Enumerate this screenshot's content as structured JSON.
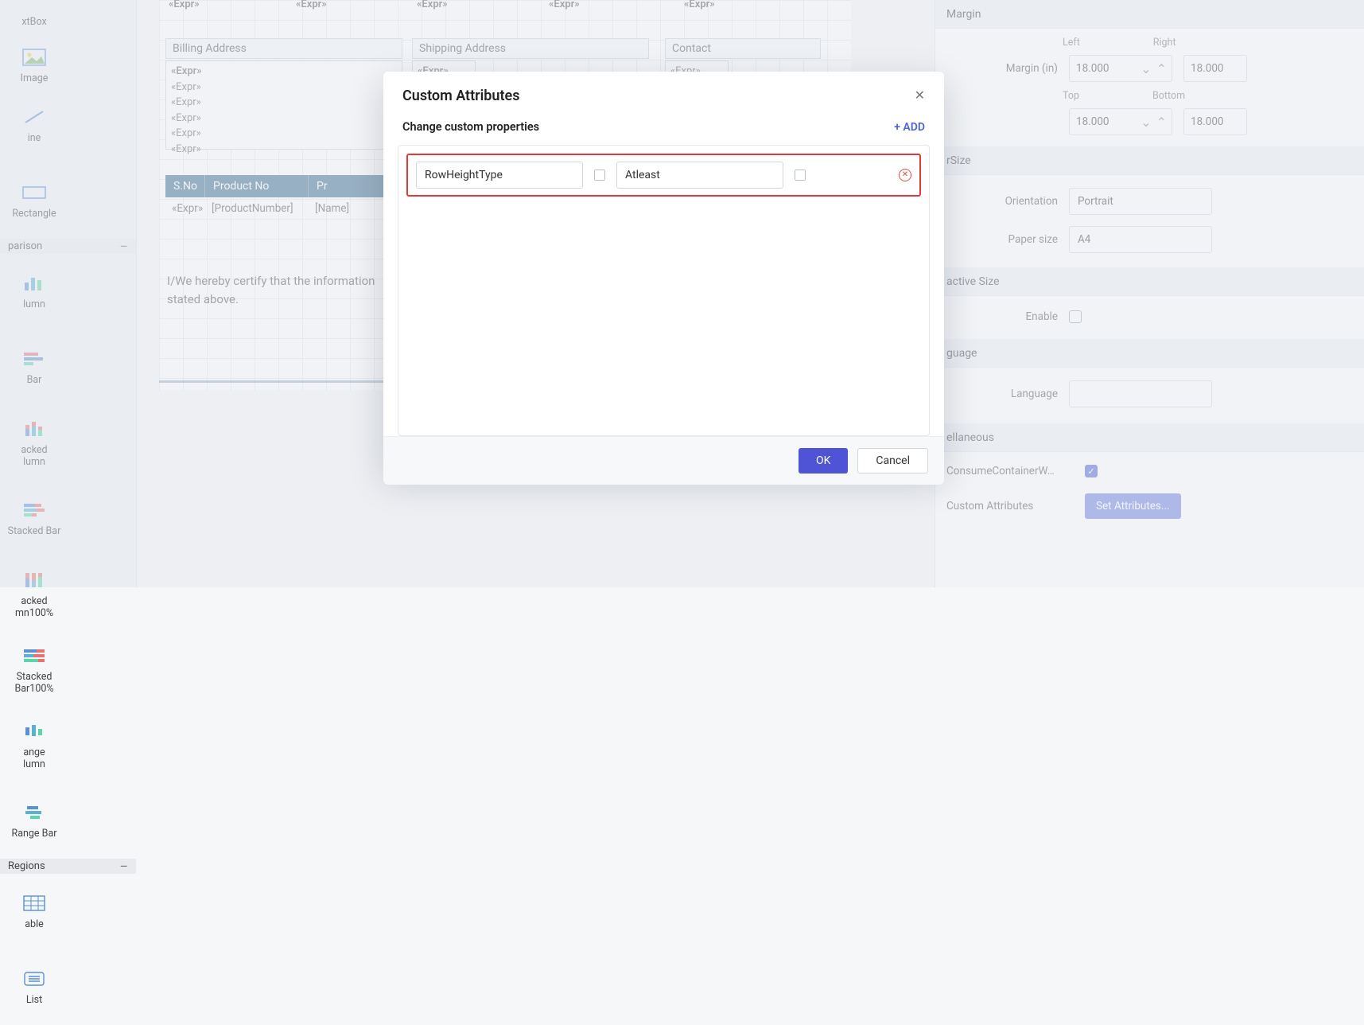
{
  "toolbox": {
    "row1": [
      {
        "label": "xtBox",
        "icon": "textbox"
      },
      {
        "label": "Image",
        "icon": "image"
      }
    ],
    "row2": [
      {
        "label": "ine",
        "icon": "line"
      },
      {
        "label": "Rectangle",
        "icon": "rect"
      }
    ],
    "comparison_head": "parison",
    "comp_rows": [
      [
        {
          "label": "lumn",
          "icon": "col"
        },
        {
          "label": "Bar",
          "icon": "bar"
        }
      ],
      [
        {
          "label": "acked\nlumn",
          "icon": "scol"
        },
        {
          "label": "Stacked Bar",
          "icon": "sbar"
        }
      ],
      [
        {
          "label": "acked\nmn100%",
          "icon": "scol100"
        },
        {
          "label": "Stacked\nBar100%",
          "icon": "sbar100"
        }
      ],
      [
        {
          "label": "ange\nlumn",
          "icon": "rcol"
        },
        {
          "label": "Range Bar",
          "icon": "rbar"
        }
      ]
    ],
    "regions_head": "Regions",
    "regions_rows": [
      [
        {
          "label": "able",
          "icon": "table"
        },
        {
          "label": "List",
          "icon": "list"
        }
      ]
    ]
  },
  "canvas": {
    "top_exprs": [
      "«Expr»",
      "«Expr»",
      "«Expr»",
      "«Expr»",
      "«Expr»"
    ],
    "billing_head": "Billing Address",
    "shipping_head": "Shipping Address",
    "contact_head": "Contact",
    "expr_short": "«Expr»",
    "table_headers": [
      "S.No",
      "Product No",
      "Pr"
    ],
    "table_row": [
      "«Expr»",
      "[ProductNumber]",
      "[Name]"
    ],
    "cert_line1": "I/We hereby certify that the information",
    "cert_line2": "stated above."
  },
  "props": {
    "margin_head": "Margin",
    "margin_label": "Margin (in)",
    "left_lbl": "Left",
    "right_lbl": "Right",
    "top_lbl": "Top",
    "bottom_lbl": "Bottom",
    "m_left": "18.000",
    "m_right": "18.000",
    "m_top": "18.000",
    "m_bottom": "18.000",
    "size_head": "rSize",
    "orientation_lbl": "Orientation",
    "orientation_val": "Portrait",
    "papersize_lbl": "Paper size",
    "papersize_val": "A4",
    "active_head": "active Size",
    "enable_lbl": "Enable",
    "lang_head": "guage",
    "lang_lbl": "Language",
    "misc_head": "ellaneous",
    "consume_lbl": "ConsumeContainerW…",
    "customattr_lbl": "Custom Attributes",
    "setattr_btn": "Set Attributes..."
  },
  "modal": {
    "title": "Custom Attributes",
    "sub": "Change custom properties",
    "add": "+ ADD",
    "row": {
      "key": "RowHeightType",
      "value": "Atleast"
    },
    "ok": "OK",
    "cancel": "Cancel"
  }
}
